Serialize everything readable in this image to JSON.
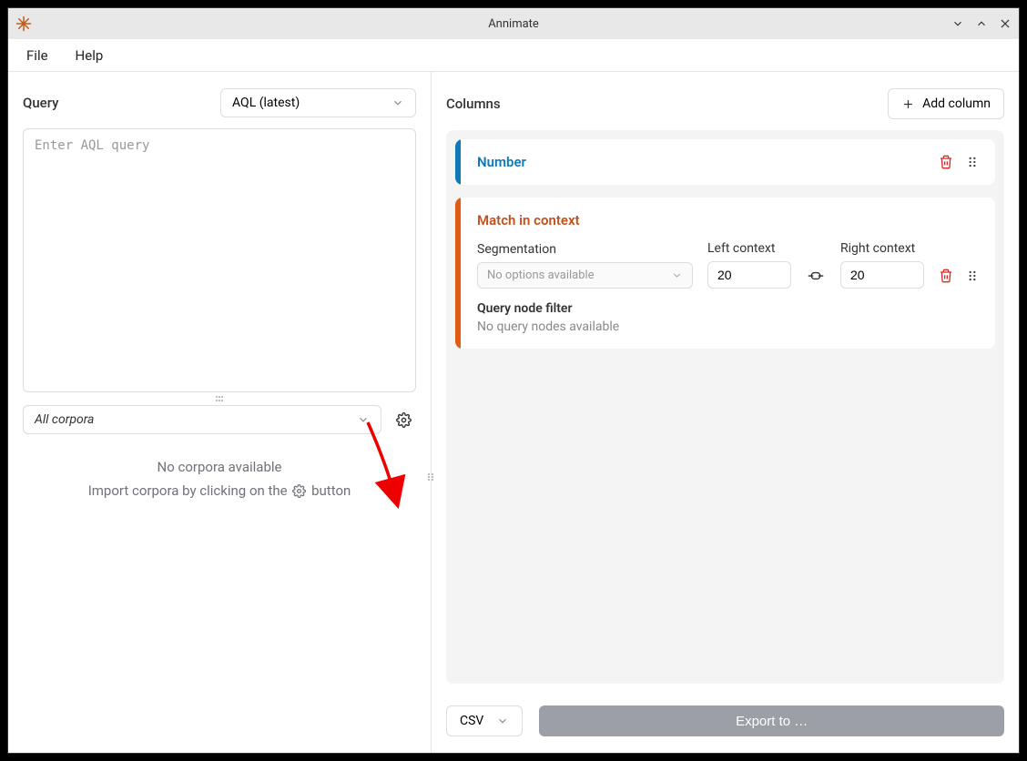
{
  "window": {
    "title": "Annimate"
  },
  "menubar": {
    "file": "File",
    "help": "Help"
  },
  "query": {
    "label": "Query",
    "language_select": "AQL (latest)",
    "placeholder": "Enter AQL query"
  },
  "corpora": {
    "select_label": "All corpora",
    "empty_line1": "No corpora available",
    "empty_line2a": "Import corpora by clicking on the",
    "empty_line2b": "button"
  },
  "columns": {
    "label": "Columns",
    "add_button": "Add column",
    "number_card": {
      "title": "Number"
    },
    "context_card": {
      "title": "Match in context",
      "segmentation_label": "Segmentation",
      "segmentation_placeholder": "No options available",
      "left_label": "Left context",
      "left_value": "20",
      "right_label": "Right context",
      "right_value": "20",
      "qnf_label": "Query node filter",
      "qnf_empty": "No query nodes available"
    }
  },
  "export": {
    "format": "CSV",
    "button": "Export to …"
  }
}
